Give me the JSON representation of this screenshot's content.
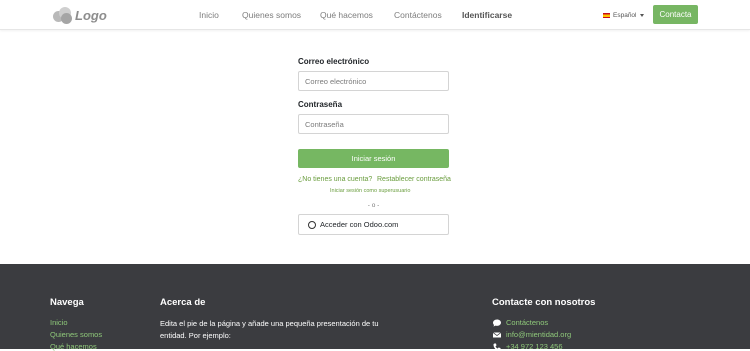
{
  "header": {
    "logo_text": "Logo",
    "nav": [
      {
        "label": "Inicio"
      },
      {
        "label": "Quienes somos"
      },
      {
        "label": "Qué hacemos"
      },
      {
        "label": "Contáctenos"
      },
      {
        "label": "Identificarse"
      }
    ],
    "language": "Español",
    "contact_button": "Contacta"
  },
  "login": {
    "email_label": "Correo electrónico",
    "email_placeholder": "Correo electrónico",
    "password_label": "Contraseña",
    "password_placeholder": "Contraseña",
    "submit_label": "Iniciar sesión",
    "no_account_link": "¿No tienes una cuenta?",
    "reset_link": "Restablecer contraseña",
    "superuser_link": "Iniciar sesión como superusuario",
    "separator": "- o -",
    "oauth_label": "Acceder con Odoo.com"
  },
  "footer": {
    "nav_title": "Navega",
    "nav_links": [
      "Inicio",
      "Quienes somos",
      "Qué hacemos"
    ],
    "about_title": "Acerca de",
    "about_text": "Edita el pie de la página y añade una pequeña presentación de tu entidad. Por ejemplo:",
    "contact_title": "Contacte con nosotros",
    "contact_items": [
      {
        "icon": "comment-icon",
        "text": "Contáctenos"
      },
      {
        "icon": "envelope-icon",
        "text": "info@mientidad.org"
      },
      {
        "icon": "phone-icon",
        "text": "+34 972 123 456"
      }
    ]
  },
  "colors": {
    "accent": "#77b663",
    "link": "#6a9d3e",
    "footer_bg": "#3b3c40",
    "footer_link": "#8fc97a"
  }
}
